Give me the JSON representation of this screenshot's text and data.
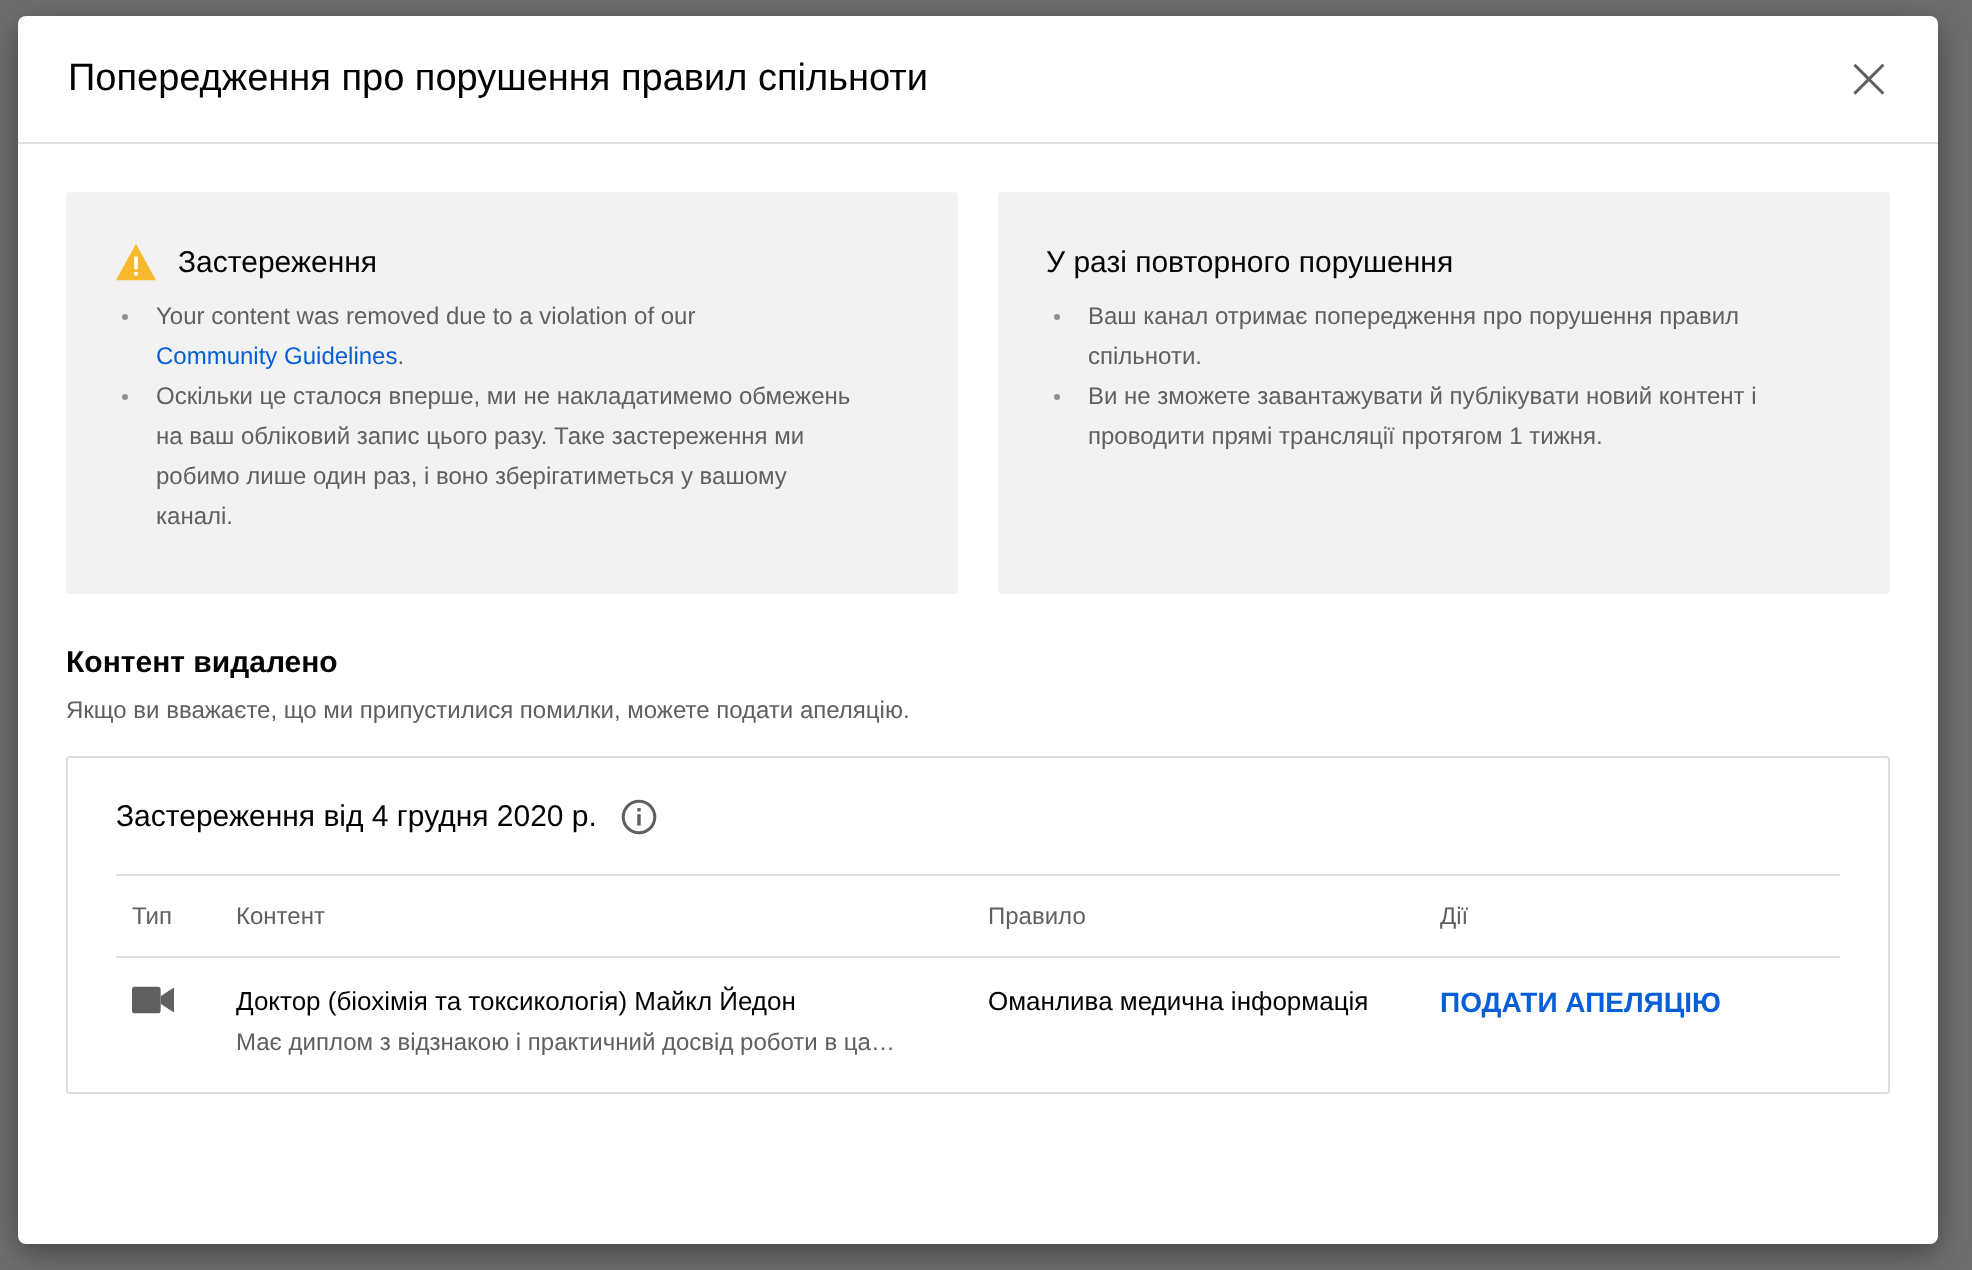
{
  "dialog": {
    "title": "Попередження про порушення правил спільноти",
    "close_label": "×"
  },
  "warning_card": {
    "title": "Застереження",
    "items": [
      {
        "text": "Your content was removed due to a violation of our",
        "link": "Community Guidelines",
        "after": "."
      },
      {
        "text": "Оскільки це сталося вперше, ми не накладатимемо обмежень на ваш обліковий запис цього разу. Таке застереження ми робимо лише один раз, і воно зберігатиметься у вашому каналі."
      }
    ]
  },
  "repeat_card": {
    "title": "У разі повторного порушення",
    "items": [
      "Ваш канал отримає попередження про порушення правил спільноти.",
      "Ви не зможете завантажувати й публікувати новий контент і проводити прямі трансляції протягом 1 тижня."
    ]
  },
  "removed": {
    "title": "Контент видалено",
    "description": "Якщо ви вважаєте, що ми припустилися помилки, можете подати апеляцію."
  },
  "strike": {
    "title": "Застереження від 4 грудня 2020 р.",
    "columns": [
      "Тип",
      "Контент",
      "Правило",
      "Дії"
    ],
    "rows": [
      {
        "kind": "video",
        "content_title": "Доктор (біохімія та токсикологія) Майкл Йедон",
        "content_description": "Має диплом з відзнакою і практичний досвід роботи в ца…",
        "rule": "Оманлива медична інформація",
        "action": "ПОДАТИ АПЕЛЯЦІЮ"
      }
    ]
  }
}
